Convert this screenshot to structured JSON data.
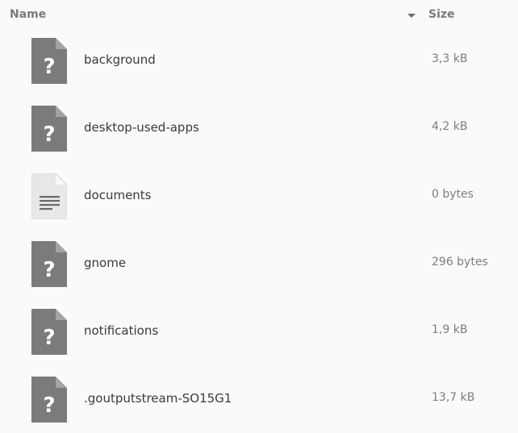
{
  "header": {
    "name_label": "Name",
    "size_label": "Size",
    "sort_icon": "sort-descending-arrow-icon"
  },
  "files": [
    {
      "name": "background",
      "size": "3,3 kB",
      "icon": "unknown-file-icon"
    },
    {
      "name": "desktop-used-apps",
      "size": "4,2 kB",
      "icon": "unknown-file-icon"
    },
    {
      "name": "documents",
      "size": "0 bytes",
      "icon": "text-file-icon"
    },
    {
      "name": "gnome",
      "size": "296 bytes",
      "icon": "unknown-file-icon"
    },
    {
      "name": "notifications",
      "size": "1,9 kB",
      "icon": "unknown-file-icon"
    },
    {
      "name": ".goutputstream-SO15G1",
      "size": "13,7 kB",
      "icon": "unknown-file-icon"
    }
  ],
  "colors": {
    "background": "#fafafa",
    "unknown_icon": "#7b7b7b",
    "text_icon": "#e6e6e6"
  }
}
